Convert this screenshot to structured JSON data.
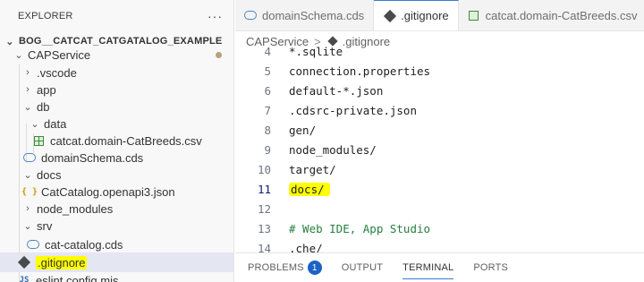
{
  "explorer": {
    "title": "EXPLORER",
    "more_label": "···",
    "workspace": "BOG__CATCAT_CATGATALOG_EXAMPLE",
    "tree": [
      {
        "label": "CAPService",
        "type": "folder-open",
        "modified": true
      },
      {
        "label": ".vscode",
        "type": "folder"
      },
      {
        "label": "app",
        "type": "folder"
      },
      {
        "label": "db",
        "type": "folder-open"
      },
      {
        "label": "data",
        "type": "folder-open"
      },
      {
        "label": "catcat.domain-CatBreeds.csv",
        "type": "csv"
      },
      {
        "label": "domainSchema.cds",
        "type": "cds"
      },
      {
        "label": "docs",
        "type": "folder-open"
      },
      {
        "label": "CatCatalog.openapi3.json",
        "type": "json"
      },
      {
        "label": "node_modules",
        "type": "folder"
      },
      {
        "label": "srv",
        "type": "folder-open"
      },
      {
        "label": "cat-catalog.cds",
        "type": "cds"
      },
      {
        "label": ".gitignore",
        "type": "git",
        "selected": true
      },
      {
        "label": "eslint.config.mjs",
        "type": "js"
      }
    ]
  },
  "tabs": [
    {
      "label": "domainSchema.cds",
      "icon": "cds-icon",
      "active": false
    },
    {
      "label": ".gitignore",
      "icon": "git-icon",
      "active": true
    },
    {
      "label": "catcat.domain-CatBreeds.csv",
      "icon": "csv-icon",
      "active": false
    }
  ],
  "breadcrumb": {
    "folder": "CAPService",
    "separator": ">",
    "file": ".gitignore"
  },
  "code_lines": [
    {
      "n": "4",
      "text": "*.sqlite"
    },
    {
      "n": "5",
      "text": "connection.properties"
    },
    {
      "n": "6",
      "text": "default-*.json"
    },
    {
      "n": "7",
      "text": ".cdsrc-private.json"
    },
    {
      "n": "8",
      "text": "gen/"
    },
    {
      "n": "9",
      "text": "node_modules/"
    },
    {
      "n": "10",
      "text": "target/"
    },
    {
      "n": "11",
      "text": "docs/"
    },
    {
      "n": "12",
      "text": ""
    },
    {
      "n": "13",
      "text": "# Web IDE, App Studio"
    },
    {
      "n": "14",
      "text": ".che/"
    }
  ],
  "panel": {
    "tabs": [
      {
        "label": "PROBLEMS",
        "badge": "1"
      },
      {
        "label": "OUTPUT"
      },
      {
        "label": "TERMINAL",
        "active": true
      },
      {
        "label": "PORTS"
      }
    ]
  },
  "colors": {
    "highlight": "#ffff00",
    "accent": "#3a7bd5",
    "badge": "#1a63c4"
  }
}
